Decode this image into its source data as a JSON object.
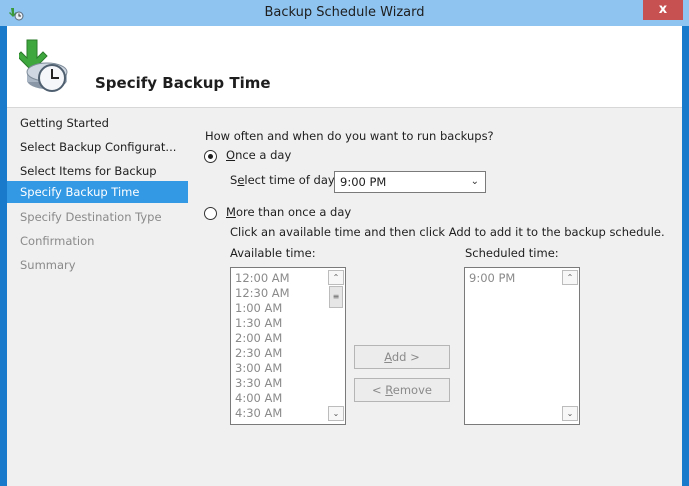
{
  "window": {
    "title": "Backup Schedule Wizard",
    "close_label": "x"
  },
  "header": {
    "title": "Specify Backup Time",
    "icon": "backup-clock-icon"
  },
  "sidebar": {
    "items": [
      {
        "label": "Getting Started",
        "state": "normal"
      },
      {
        "label": "Select Backup Configurat...",
        "state": "normal"
      },
      {
        "label": "Select Items for Backup",
        "state": "normal"
      },
      {
        "label": "Specify Backup Time",
        "state": "active"
      },
      {
        "label": "Specify Destination Type",
        "state": "disabled"
      },
      {
        "label": "Confirmation",
        "state": "disabled"
      },
      {
        "label": "Summary",
        "state": "disabled"
      }
    ]
  },
  "main": {
    "question": "How often and when do you want to run backups?",
    "once": {
      "label_key": "O",
      "label_rest": "nce a day",
      "selected": true
    },
    "time_select": {
      "label_pre": "S",
      "label_key": "e",
      "label_rest": "lect time of day:",
      "value": "9:00 PM"
    },
    "more": {
      "label_key": "M",
      "label_rest": "ore than once a day",
      "selected": false
    },
    "instructions": "Click an available time and then click Add to add it to the backup schedule.",
    "available": {
      "label": "Available time:",
      "items": [
        "12:00 AM",
        "12:30 AM",
        "1:00 AM",
        "1:30 AM",
        "2:00 AM",
        "2:30 AM",
        "3:00 AM",
        "3:30 AM",
        "4:00 AM",
        "4:30 AM"
      ]
    },
    "scheduled": {
      "label": "Scheduled time:",
      "items": [
        "9:00 PM"
      ]
    },
    "add_button": {
      "key": "A",
      "rest": "dd >"
    },
    "remove_button": {
      "pre": "< ",
      "key": "R",
      "rest": "emove"
    }
  },
  "colors": {
    "accent": "#3399e4",
    "titlebar": "#8fc4f0",
    "frame": "#1979ca",
    "close": "#c75050"
  }
}
